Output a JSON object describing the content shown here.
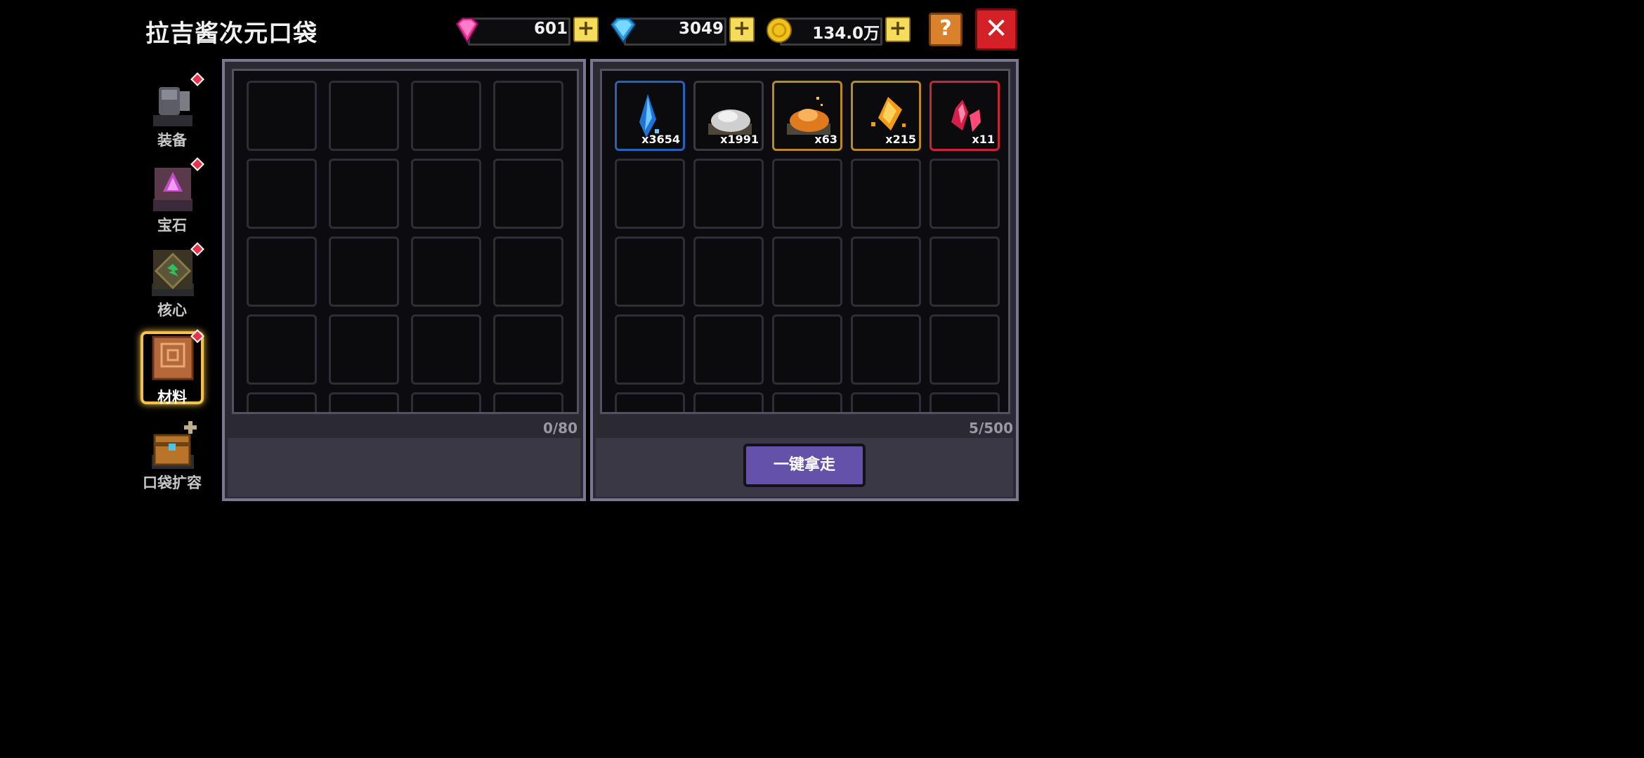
{
  "header": {
    "title": "拉吉酱次元口袋"
  },
  "currencies": [
    {
      "icon": "pink-gem-icon",
      "value": "601",
      "color": "#e8339a"
    },
    {
      "icon": "blue-diamond-icon",
      "value": "3049",
      "color": "#3fb4ef"
    },
    {
      "icon": "gold-coin-icon",
      "value": "134.0万",
      "color": "#f2c21c"
    }
  ],
  "buttons": {
    "help": "?",
    "close": "✕",
    "take_all": "一键拿走"
  },
  "sidebar": {
    "items": [
      {
        "label": "装备",
        "icon": "armor-icon",
        "badge": true
      },
      {
        "label": "宝石",
        "icon": "gem-altar-icon",
        "badge": true
      },
      {
        "label": "核心",
        "icon": "core-icon",
        "badge": true
      },
      {
        "label": "材料",
        "icon": "material-book-icon",
        "badge": true,
        "active": true
      },
      {
        "label": "口袋扩容",
        "icon": "expand-chest-icon",
        "badge": false
      }
    ]
  },
  "left_panel": {
    "count": "0/80"
  },
  "right_panel": {
    "count": "5/500",
    "items": [
      {
        "icon": "blue-crystal-icon",
        "qty": "x3654",
        "rarity": "blue"
      },
      {
        "icon": "silver-ore-icon",
        "qty": "x1991",
        "rarity": "gray"
      },
      {
        "icon": "orange-ore-icon",
        "qty": "x63",
        "rarity": "gold"
      },
      {
        "icon": "gold-shard-icon",
        "qty": "x215",
        "rarity": "gold"
      },
      {
        "icon": "red-crystal-icon",
        "qty": "x11",
        "rarity": "red"
      }
    ]
  }
}
